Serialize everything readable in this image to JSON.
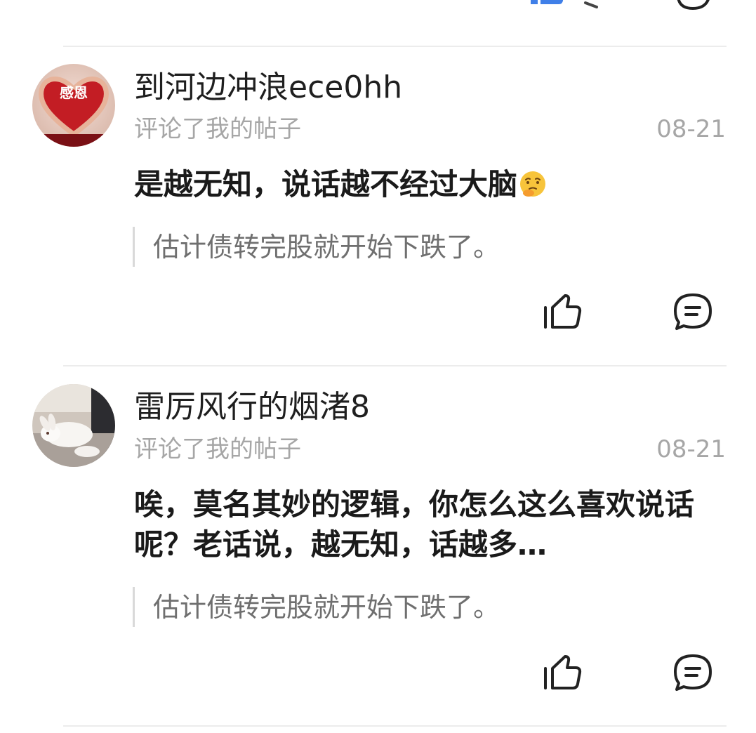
{
  "colors": {
    "like_active": "#3f7fe8",
    "divider": "#ececec",
    "secondary_text": "#a6a6a6",
    "quote_text": "#6f6f6f"
  },
  "comments": [
    {
      "username": "到河边冲浪ece0hh",
      "action": "评论了我的帖子",
      "date": "08-21",
      "reply": "是越无知，说话越不经过大脑",
      "reply_emoji": "thinking-face-emoji",
      "quoted_post": "估计债转完股就开始下跌了。",
      "avatar_icon": "heart-hands-avatar",
      "avatar_text": "感恩"
    },
    {
      "username": "雷厉风行的烟渚8",
      "action": "评论了我的帖子",
      "date": "08-21",
      "reply": "唉，莫名其妙的逻辑，你怎么这么喜欢说话呢？老话说，越无知，话越多…",
      "quoted_post": "估计债转完股就开始下跌了。",
      "avatar_icon": "white-rabbit-avatar"
    }
  ],
  "icons": {
    "like": "thumbs-up-icon",
    "reply": "comment-bubble-icon"
  }
}
